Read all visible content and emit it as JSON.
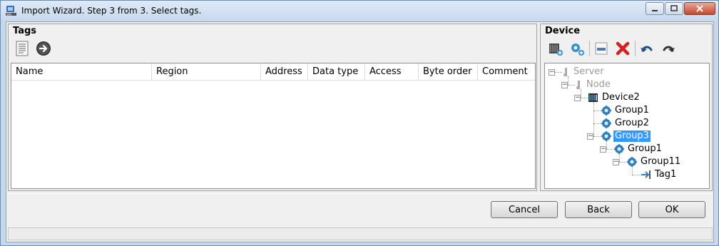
{
  "window": {
    "title": "Import Wizard. Step 3 from 3. Select tags."
  },
  "tags_panel": {
    "title": "Tags",
    "toolbar": [
      "document-list-icon",
      "arrow-right-circle-icon"
    ],
    "columns": [
      "Name",
      "Region",
      "Address",
      "Data type",
      "Access",
      "Byte order",
      "Comment"
    ],
    "rows": []
  },
  "device_panel": {
    "title": "Device",
    "toolbar": [
      "add-device-icon",
      "add-group-icon",
      "add-tag-icon",
      "delete-icon",
      "undo-icon",
      "redo-icon"
    ],
    "tree": [
      {
        "label": "Server",
        "level": 0,
        "expanded": true,
        "disabled": true,
        "icon": "server-icon"
      },
      {
        "label": "Node",
        "level": 1,
        "expanded": true,
        "disabled": true,
        "icon": "node-icon"
      },
      {
        "label": "Device2",
        "level": 2,
        "expanded": true,
        "icon": "device-icon"
      },
      {
        "label": "Group1",
        "level": 3,
        "icon": "group-icon"
      },
      {
        "label": "Group2",
        "level": 3,
        "icon": "group-icon"
      },
      {
        "label": "Group3",
        "level": 3,
        "expanded": true,
        "selected": true,
        "icon": "group-icon"
      },
      {
        "label": "Group1",
        "level": 4,
        "expanded": true,
        "icon": "group-icon"
      },
      {
        "label": "Group11",
        "level": 5,
        "expanded": true,
        "icon": "group-icon"
      },
      {
        "label": "Tag1",
        "level": 6,
        "icon": "tag-icon"
      }
    ]
  },
  "buttons": {
    "cancel": "Cancel",
    "back": "Back",
    "ok": "OK"
  }
}
